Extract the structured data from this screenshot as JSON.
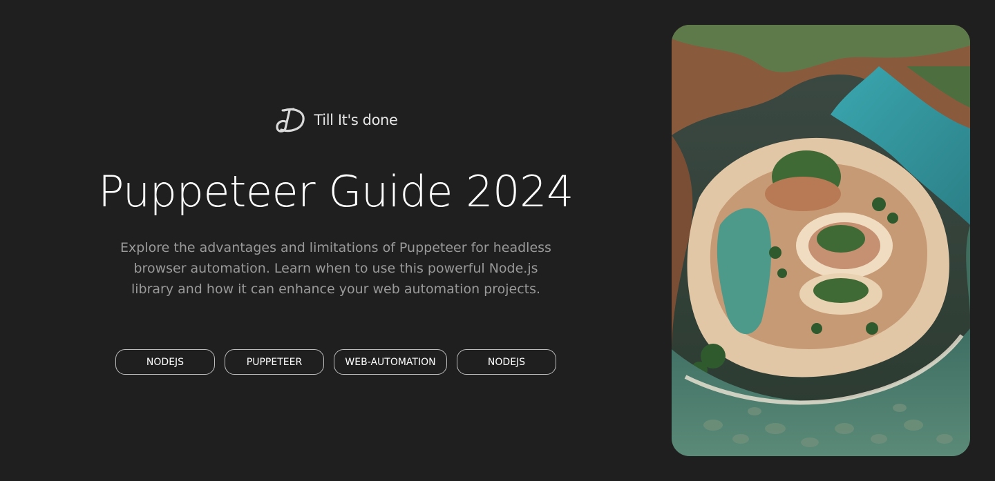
{
  "brand": {
    "name": "Till It's done",
    "logo_icon": "td-monogram-icon"
  },
  "hero": {
    "title": "Puppeteer Guide 2024",
    "description": "Explore the advantages and limitations of Puppeteer for headless browser automation. Learn when to use this powerful Node.js library and how it can enhance your web automation projects."
  },
  "tags": [
    {
      "label": "NODEJS"
    },
    {
      "label": "PUPPETEER"
    },
    {
      "label": "WEB-AUTOMATION"
    },
    {
      "label": "NODEJS"
    }
  ],
  "cover": {
    "icon": "aerial-canyon-river-image"
  },
  "colors": {
    "background": "#1f1f1f",
    "text": "#ffffff",
    "muted_text": "#9a9a9a",
    "tag_border": "#bdbdbd"
  }
}
